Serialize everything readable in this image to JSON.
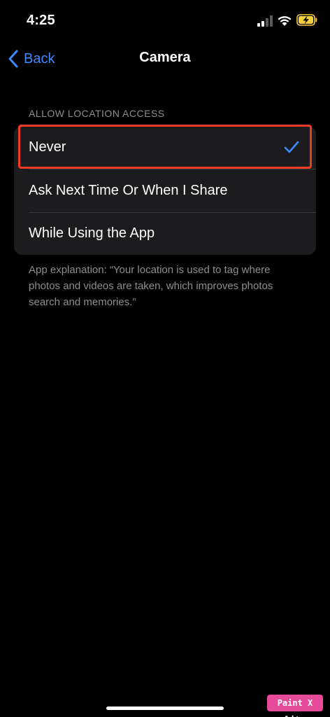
{
  "status_bar": {
    "time": "4:25",
    "icons": [
      "signal-icon",
      "wifi-icon",
      "battery-charging-icon"
    ]
  },
  "nav": {
    "back_label": "Back",
    "title": "Camera"
  },
  "section": {
    "header": "ALLOW LOCATION ACCESS",
    "options": [
      {
        "label": "Never",
        "selected": true
      },
      {
        "label": "Ask Next Time Or When I Share",
        "selected": false
      },
      {
        "label": "While Using the App",
        "selected": false
      }
    ],
    "footer": "App explanation: “Your location is used to tag where photos and videos are taken, which improves photos search and memories.”"
  },
  "watermark": "Paint X lite",
  "colors": {
    "accent": "#3d8bfd",
    "highlight": "#ef3b24",
    "group_bg": "#1c1c1e",
    "secondary_text": "#8d8d92"
  }
}
